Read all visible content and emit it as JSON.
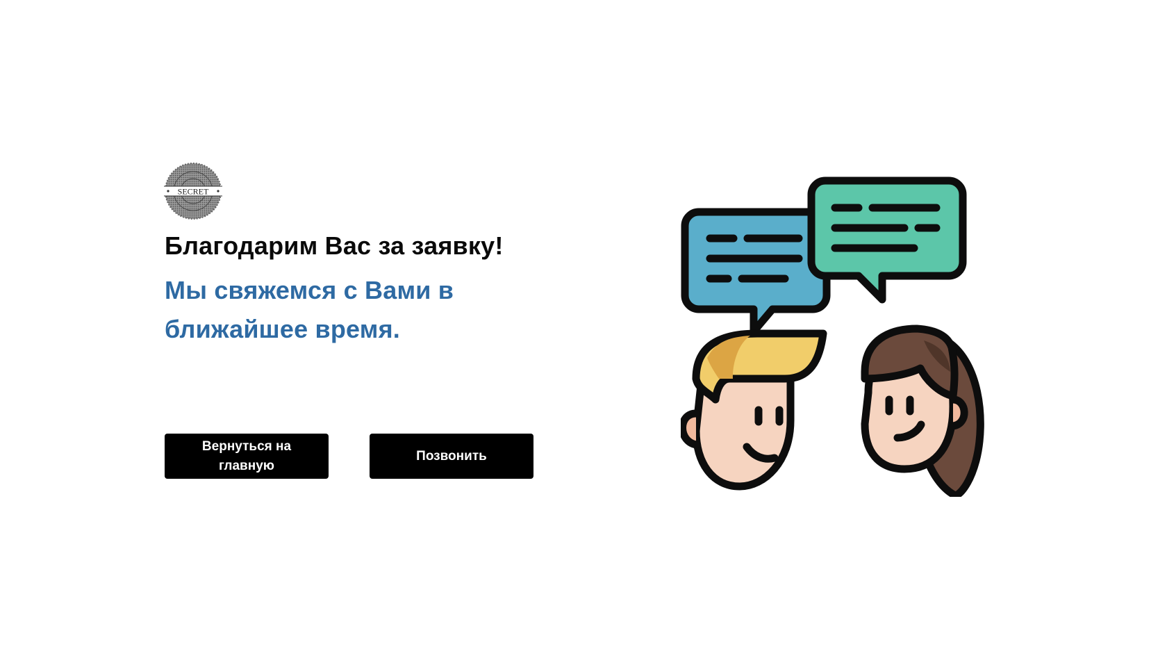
{
  "logo": {
    "text": "SECRET",
    "icon": "secret-seal-logo"
  },
  "heading": "Благодарим Вас за заявку!",
  "subheading": "Мы свяжемся с Вами в ближайшее время.",
  "buttons": {
    "home_label": "Вернуться на главную",
    "call_label": "Позвонить"
  },
  "illustration": {
    "icon": "chat-people-illustration"
  },
  "colors": {
    "heading": "#0a0a0a",
    "accent_blue": "#2e6aa3",
    "button_bg": "#000000",
    "bubble_blue": "#5aaecb",
    "bubble_green": "#5cc6a9",
    "hair_blond": "#f1cd6a",
    "hair_brown": "#6b4a3c",
    "skin": "#f6d4c0"
  }
}
